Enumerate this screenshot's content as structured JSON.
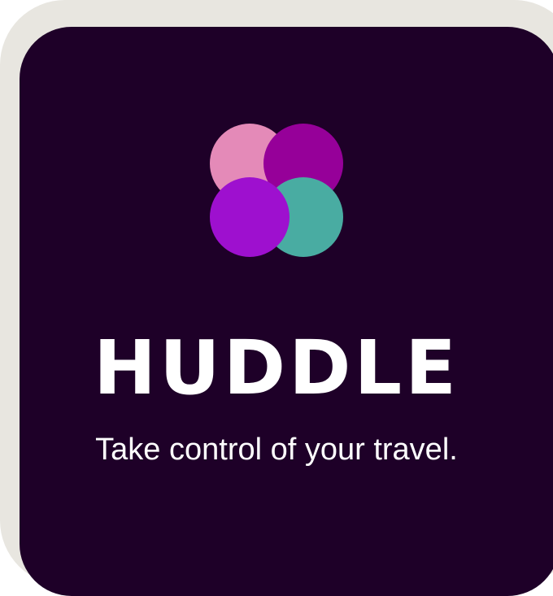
{
  "app": {
    "name": "HUDDLE",
    "tagline": "Take control of your travel."
  },
  "logo": {
    "icon": "four-circles-logo-icon",
    "colors": [
      "#e48ab8",
      "#960099",
      "#9e10cf",
      "#49aca2"
    ]
  },
  "theme": {
    "background": "#1e0028",
    "frame": "#e8e6e0",
    "text": "#ffffff"
  }
}
